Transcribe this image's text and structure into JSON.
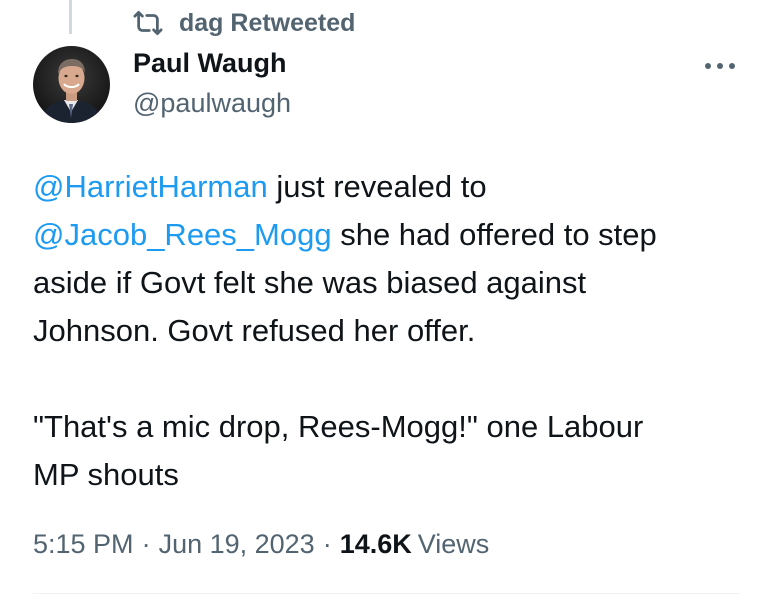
{
  "retweet": {
    "icon": "retweet-icon",
    "label": "dag Retweeted"
  },
  "author": {
    "name": "Paul Waugh",
    "handle": "@paulwaugh",
    "avatar_icon": "avatar-photo"
  },
  "more_icon": "more-options-icon",
  "tweet": {
    "line1_mention": "@HarrietHarman",
    "line1_text": " just revealed to",
    "line2_mention": "@Jacob_Rees_Mogg",
    "line2_text": " she had offered to step",
    "line3_text": "aside if Govt felt she was biased against",
    "line4_text": "Johnson. Govt refused her offer.",
    "line6_text": "\"That's a mic drop, Rees-Mogg!\" one Labour",
    "line7_text": "MP shouts"
  },
  "meta": {
    "time": "5:15 PM",
    "separator": "·",
    "date": "Jun 19, 2023",
    "views_count": "14.6K",
    "views_label": "Views"
  },
  "colors": {
    "link": "#1d9bf0",
    "secondary_text": "#536471",
    "primary_text": "#0f1419"
  }
}
